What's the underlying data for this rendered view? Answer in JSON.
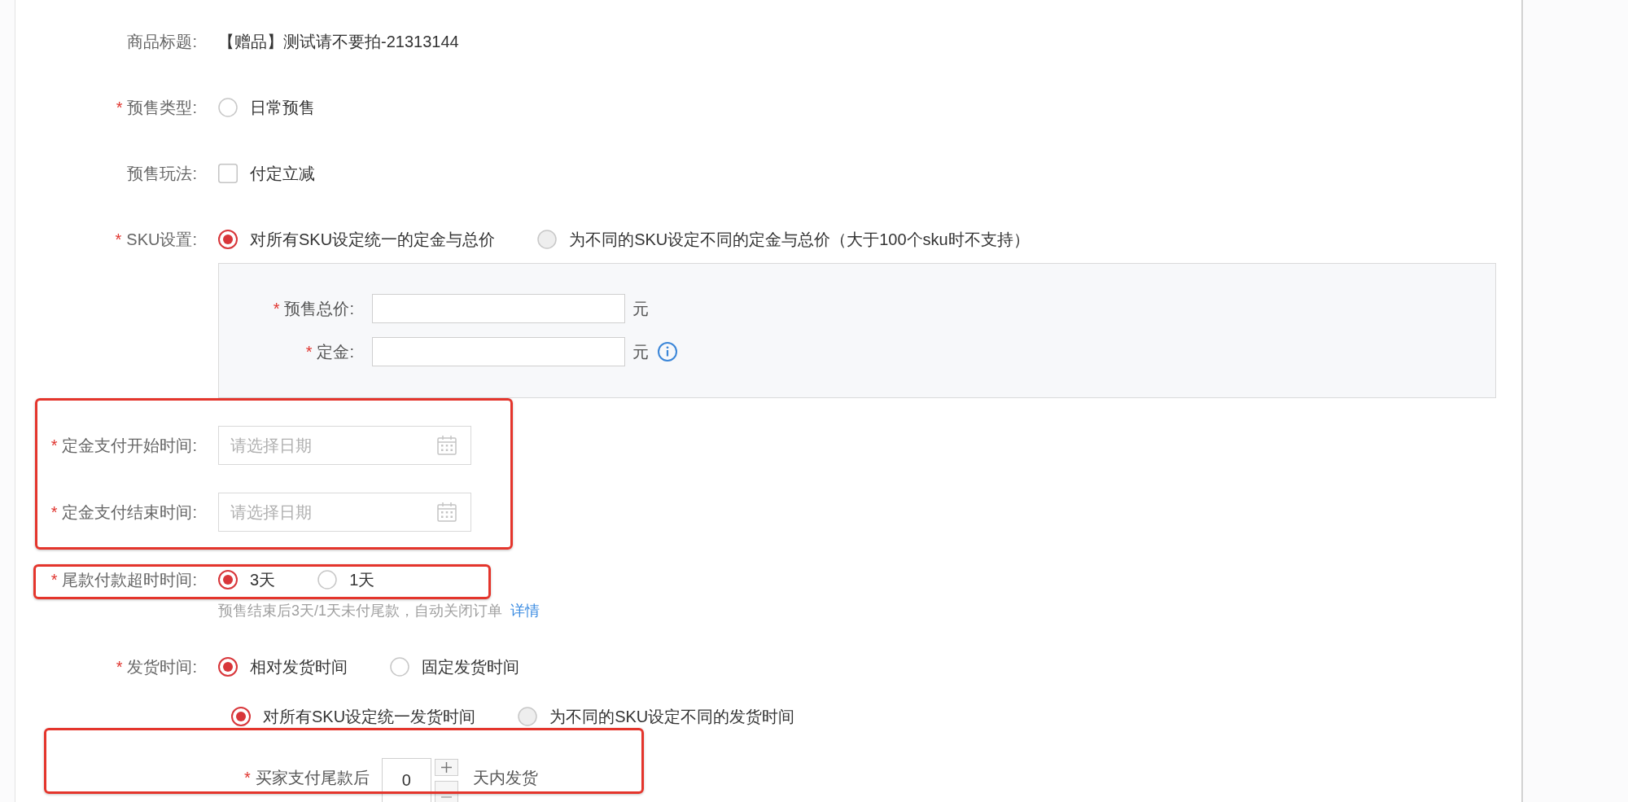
{
  "form": {
    "sections": [
      {
        "highlighted": false,
        "rows": [
          {
            "kind": "text",
            "label": "商品标题:",
            "value": "【赠品】测试请不要拍-21313144"
          },
          {
            "kind": "radio",
            "mark": "*",
            "label": "预售类型:",
            "options": [
              {
                "label": "日常预售",
                "selected": false,
                "disabled": false
              }
            ]
          },
          {
            "kind": "checkbox",
            "label": "预售玩法:",
            "options": [
              {
                "label": "付定立减",
                "checked": false
              }
            ]
          },
          {
            "kind": "radio",
            "mark": "*",
            "label": "SKU设置:",
            "options": [
              {
                "label": "对所有SKU设定统一的定金与总价",
                "selected": true,
                "disabled": false
              },
              {
                "label": "为不同的SKU设定不同的定金与总价（大于100个sku时不支持）",
                "selected": false,
                "disabled": true
              }
            ]
          },
          {
            "kind": "panel",
            "fields": [
              {
                "mark": "*",
                "label": "预售总价:",
                "unit": "元",
                "info": false
              },
              {
                "mark": "*",
                "label": "定金:",
                "unit": "元",
                "info": true
              }
            ]
          }
        ]
      },
      {
        "highlighted": true,
        "rows": [
          {
            "kind": "date",
            "mark": "*",
            "label": "定金支付开始时间:",
            "placeholder": "请选择日期"
          },
          {
            "kind": "date",
            "mark": "*",
            "label": "定金支付结束时间:",
            "placeholder": "请选择日期"
          }
        ]
      },
      {
        "highlighted": true,
        "rows": [
          {
            "kind": "radio",
            "mark": "*",
            "label": "尾款付款超时时间:",
            "options": [
              {
                "label": "3天",
                "selected": true,
                "disabled": false
              },
              {
                "label": "1天",
                "selected": false,
                "disabled": false
              }
            ]
          }
        ]
      },
      {
        "highlighted": false,
        "rows": [
          {
            "kind": "hint",
            "text": "预售结束后3天/1天未付尾款，自动关闭订单",
            "link": "详情"
          },
          {
            "kind": "radio",
            "mark": "*",
            "label": "发货时间:",
            "options": [
              {
                "label": "相对发货时间",
                "selected": true,
                "disabled": false
              },
              {
                "label": "固定发货时间",
                "selected": false,
                "disabled": false
              }
            ]
          },
          {
            "kind": "subradio",
            "options": [
              {
                "label": "对所有SKU设定统一发货时间",
                "selected": true,
                "disabled": false
              },
              {
                "label": "为不同的SKU设定不同的发货时间",
                "selected": false,
                "disabled": true
              }
            ]
          }
        ]
      },
      {
        "highlighted": true,
        "rows": [
          {
            "kind": "stepper",
            "mark": "*",
            "label": "买家支付尾款后",
            "value": "0",
            "unit": "天内发货"
          }
        ]
      }
    ]
  }
}
